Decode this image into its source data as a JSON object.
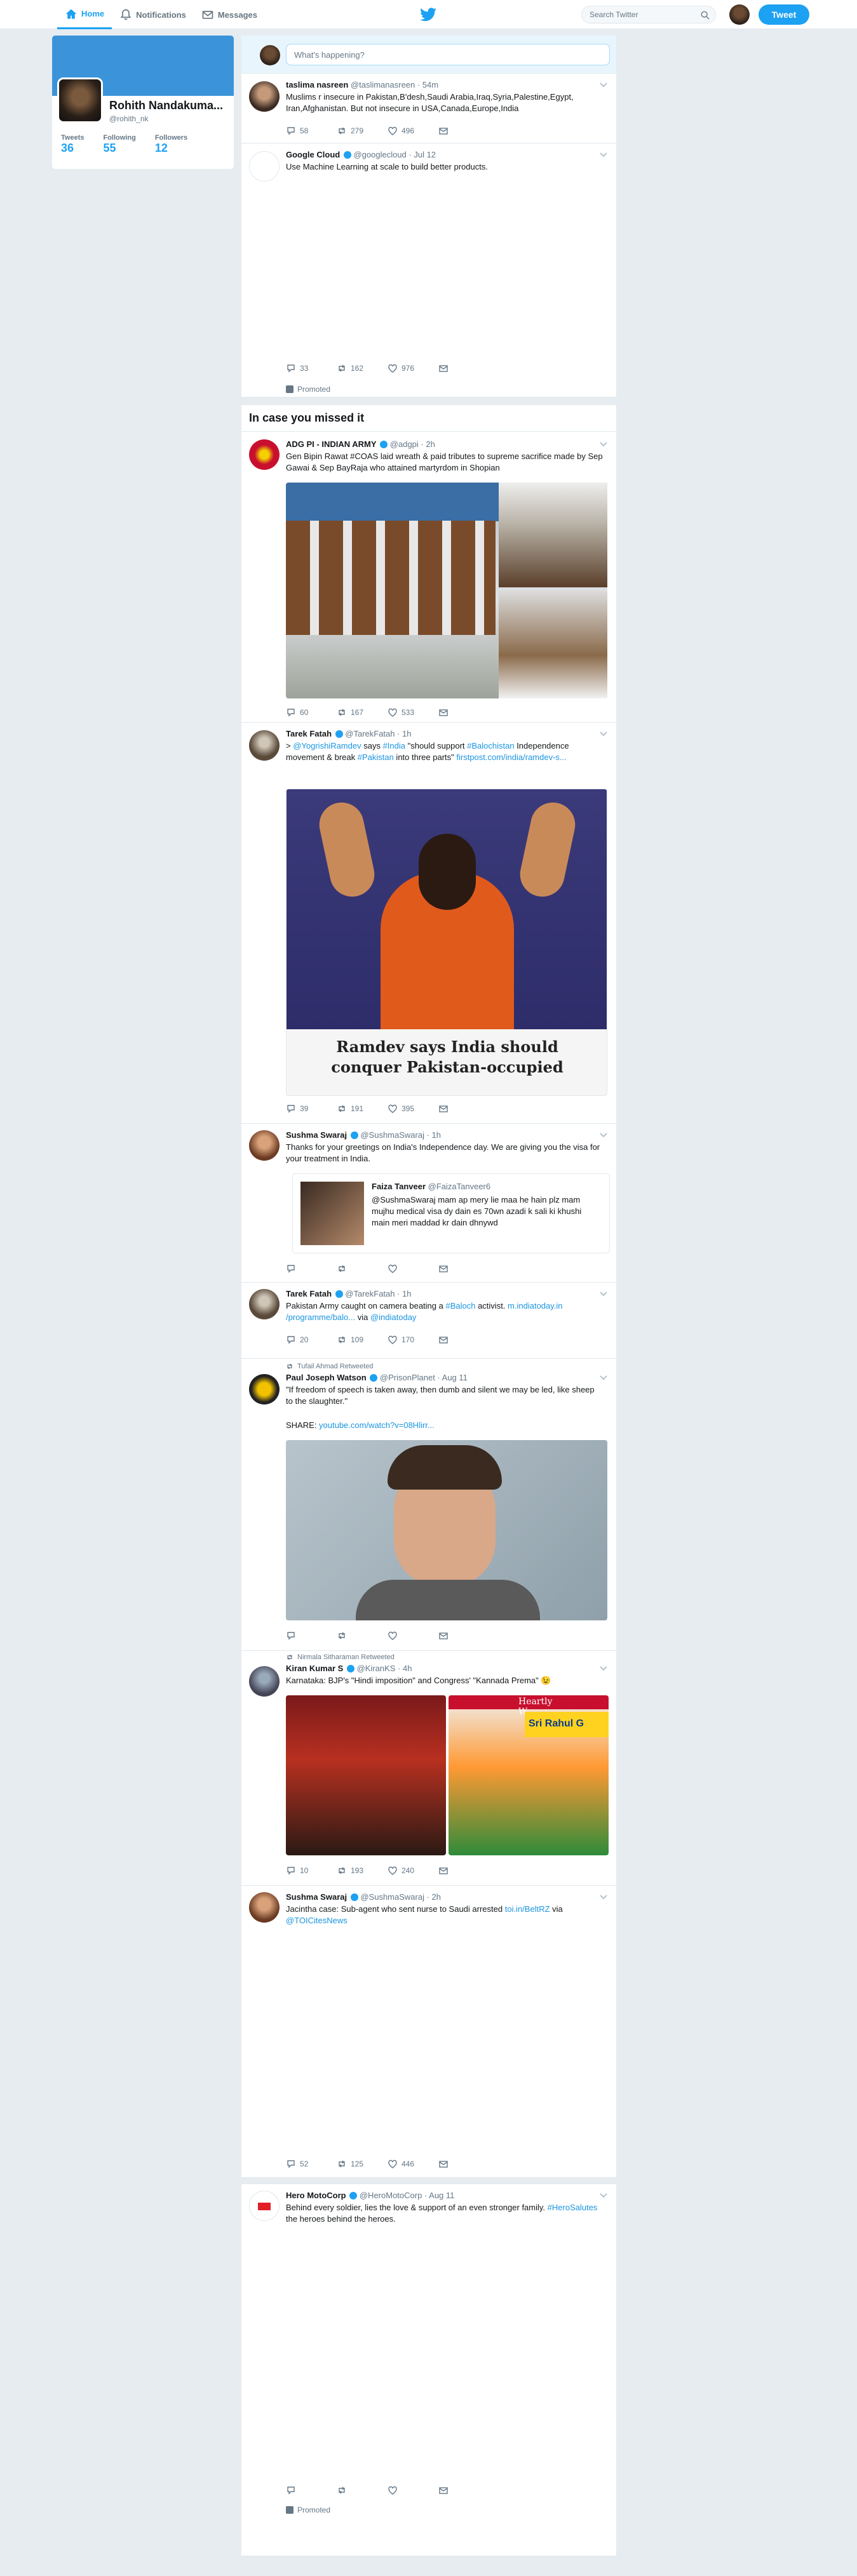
{
  "nav": {
    "home": "Home",
    "notifications": "Notifications",
    "messages": "Messages",
    "search_placeholder": "Search Twitter",
    "tweet_button": "Tweet"
  },
  "profile": {
    "name": "Rohith Nandakuma...",
    "handle": "@rohith_nk",
    "tweets_label": "Tweets",
    "tweets": "36",
    "following_label": "Following",
    "following": "55",
    "followers_label": "Followers",
    "followers": "12"
  },
  "composer": {
    "placeholder": "What's happening?"
  },
  "section_title": "In case you missed it",
  "promoted_label": "Promoted",
  "tweets": [
    {
      "name": "taslima nasreen",
      "handle": "@taslimanasreen · 54m",
      "text": "Muslims r insecure in Pakistan,B'desh,Saudi Arabia,Iraq,Syria,Palestine,Egypt, Iran,Afghanistan. But not insecure in USA,Canada,Europe,India",
      "replies": "58",
      "retweets": "279",
      "likes": "496"
    },
    {
      "name": "Google Cloud",
      "handle": "@googlecloud · Jul 12",
      "text": "Use Machine Learning at scale to build better products.",
      "replies": "33",
      "retweets": "162",
      "likes": "976"
    },
    {
      "name": "ADG PI - INDIAN ARMY",
      "handle": "@adgpi · 2h",
      "text": "Gen Bipin Rawat #COAS laid wreath & paid  tributes to supreme sacrifice made by Sep Gawai & Sep BayRaja  who attained martyrdom in Shopian",
      "replies": "60",
      "retweets": "167",
      "likes": "533"
    },
    {
      "name": "Tarek Fatah",
      "handle": "@TarekFatah · 1h",
      "text_a": "> ",
      "link1": "@YogrishiRamdev",
      "text_b": " says ",
      "link2": "#India",
      "text_c": " \"should support ",
      "link3": "#Balochistan",
      "text_d": " Independence movement & break ",
      "link4": "#Pakistan",
      "text_e": " into three parts\" ",
      "link5": "firstpost.com/india/ramdev-s...",
      "headline": "Ramdev says India should conquer Pakistan-occupied",
      "replies": "39",
      "retweets": "191",
      "likes": "395"
    },
    {
      "name": "Sushma Swaraj",
      "handle": "@SushmaSwaraj · 1h",
      "text": "Thanks for your greetings on India's Independence day. We are giving you the visa for your treatment in India.",
      "quote_name": "Faiza Tanveer",
      "quote_handle": "@FaizaTanveer6",
      "quote_text": "@SushmaSwaraj mam  ap mery lie maa he hain plz mam mujhu medical visa dy dain es 70wn azadi k sali ki khushi main meri maddad kr dain dhnywd"
    },
    {
      "name": "Tarek Fatah",
      "handle": "@TarekFatah · 1h",
      "text_a": "Pakistan Army caught on camera beating a ",
      "link1": "#Baloch",
      "text_b": " activist. ",
      "link2": "m.indiatoday.in /programme/balo...",
      "text_c": " via ",
      "link3": "@indiatoday",
      "replies": "20",
      "retweets": "109",
      "likes": "170"
    },
    {
      "social": "Tufail Ahmad Retweeted",
      "name": "Paul Joseph Watson",
      "handle": "@PrisonPlanet · Aug 11",
      "text": "\"If freedom of speech is taken away, then dumb and silent we may be led, like sheep to the slaughter.\"",
      "share": "SHARE: ",
      "share_link": "youtube.com/watch?v=08Hlirr..."
    },
    {
      "social": "Nirmala Sitharaman Retweeted",
      "name": "Kiran Kumar S",
      "handle": "@KiranKS · 4h",
      "text": "Karnataka: BJP's \"Hindi imposition\" and Congress' \"Kannada Prema\" 😉",
      "img_text1": "Heartly W",
      "img_text2": "Sri Rahul G",
      "replies": "10",
      "retweets": "193",
      "likes": "240"
    },
    {
      "name": "Sushma Swaraj",
      "handle": "@SushmaSwaraj · 2h",
      "text_a": "Jacintha case: Sub-agent who sent nurse to Saudi arrested ",
      "link1": "toi.in/BeltRZ",
      "text_b": " via ",
      "link2": "@TOICitesNews",
      "replies": "52",
      "retweets": "125",
      "likes": "446"
    },
    {
      "name": "Hero MotoCorp",
      "handle": "@HeroMotoCorp · Aug 11",
      "text_a": "Behind every soldier, lies the love & support of an even stronger family. ",
      "link1": "#HeroSalutes",
      "text_b": " the heroes behind the heroes."
    }
  ],
  "icons": {
    "reply": "reply-icon",
    "retweet": "retweet-icon",
    "like": "heart-icon",
    "dm": "message-icon"
  },
  "colors": {
    "accent": "#1da1f2",
    "background": "#e6ecf0",
    "banner": "#3b94d9"
  }
}
